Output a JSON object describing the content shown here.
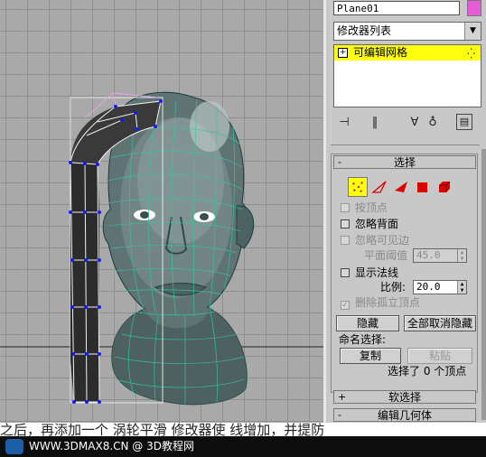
{
  "object_name": "Plane01",
  "colors": {
    "object_color": "#e75cd6",
    "stack_highlight": "#ffff10",
    "panel_bg": "#c8c8c8",
    "viewport_bg": "#a9a9a9"
  },
  "modifier_list": {
    "label": "修改器列表"
  },
  "stack": {
    "items": [
      {
        "label": "可编辑网格",
        "expand": "+",
        "icon": "vertex-subobject-icon"
      }
    ]
  },
  "toolbar": {
    "icons": [
      "pin-stack-icon",
      "show-end-result-icon",
      "make-unique-icon",
      "remove-modifier-icon",
      "configure-sets-icon"
    ]
  },
  "selection_rollout": {
    "pm": "-",
    "title": "选择",
    "subobject_icons": [
      "vertex-icon",
      "edge-icon",
      "face-icon",
      "polygon-icon",
      "element-icon"
    ],
    "by_vertex": "按顶点",
    "ignore_backfacing": "忽略背面",
    "ignore_visible_edges": "忽略可见边",
    "planar_threshold_label": "平面阈值",
    "planar_threshold_value": "45.0",
    "show_normals": "显示法线",
    "scale_label": "比例:",
    "scale_value": "20.0",
    "delete_isolated_vertices": "删除孤立顶点",
    "hide_button": "隐藏",
    "unhide_all_button": "全部取消隐藏",
    "named_selection_label": "命名选择:",
    "copy_button": "复制",
    "paste_button": "粘贴",
    "selected_status": "选择了 0 个顶点"
  },
  "soft_selection_rollout": {
    "pm": "+",
    "title": "软选择"
  },
  "edit_geometry_rollout": {
    "pm": "-",
    "title": "编辑几何体"
  },
  "caption": "之后，再添加一个 涡轮平滑 修改器使 线增加，并提防",
  "footer": {
    "text": "WWW.3DMAX8.CN @ 3D教程网"
  }
}
